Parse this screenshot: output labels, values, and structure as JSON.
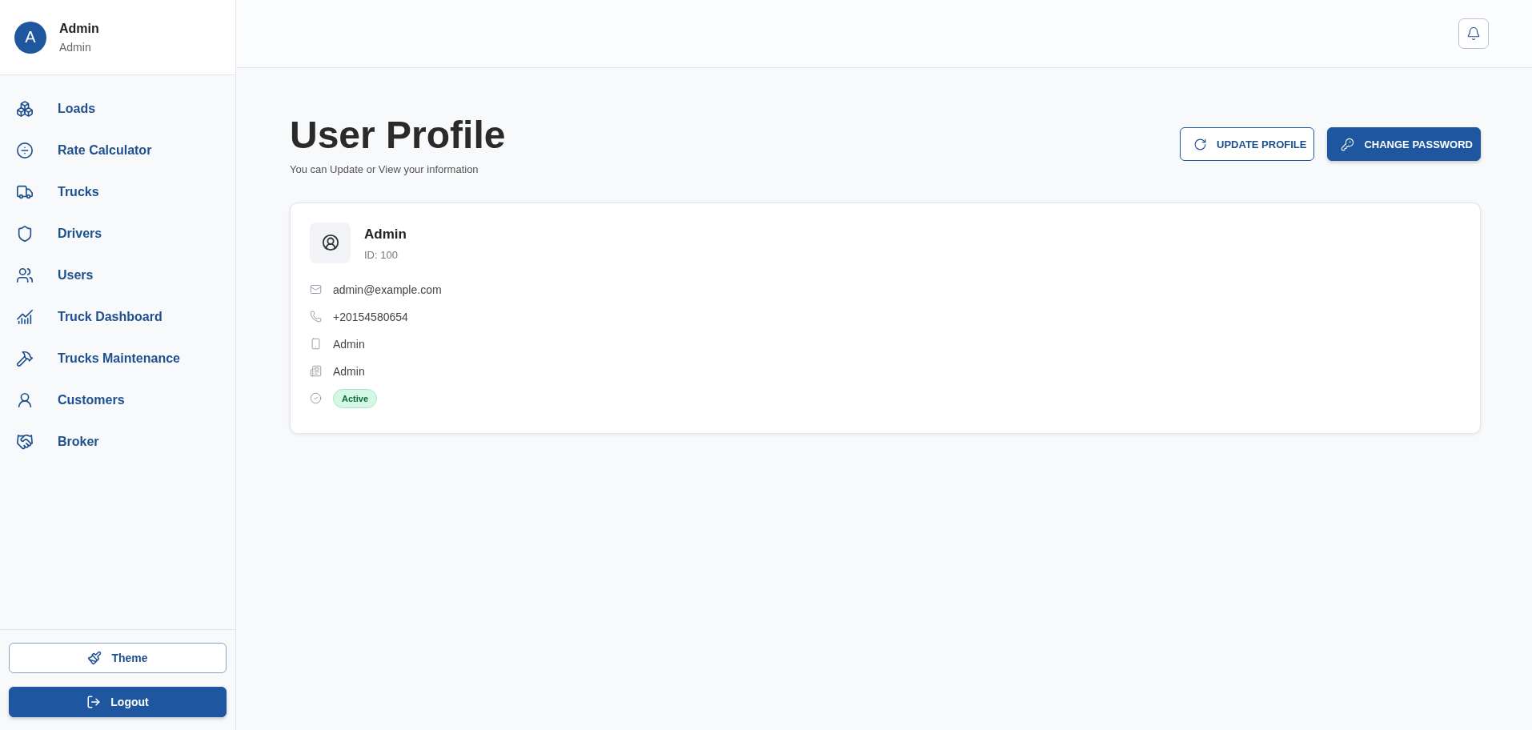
{
  "user": {
    "initial": "A",
    "name": "Admin",
    "role": "Admin"
  },
  "nav": [
    {
      "label": "Loads"
    },
    {
      "label": "Rate Calculator"
    },
    {
      "label": "Trucks"
    },
    {
      "label": "Drivers"
    },
    {
      "label": "Users"
    },
    {
      "label": "Truck Dashboard"
    },
    {
      "label": "Trucks Maintenance"
    },
    {
      "label": "Customers"
    },
    {
      "label": "Broker"
    }
  ],
  "sidebar_buttons": [
    {
      "label": "Theme",
      "kind": "outline"
    },
    {
      "label": "Logout",
      "kind": "solid"
    }
  ],
  "page": {
    "title": "User Profile",
    "subtitle": "You can Update or View your information"
  },
  "actions": [
    {
      "label": "UPDATE PROFILE",
      "kind": "outline"
    },
    {
      "label": "CHANGE PASSWORD",
      "kind": "solid"
    }
  ],
  "profile": {
    "name": "Admin",
    "id": "ID: 100"
  },
  "details": [
    {
      "kind": "email",
      "value": "admin@example.com"
    },
    {
      "kind": "phone",
      "value": "+20154580654"
    },
    {
      "kind": "device",
      "value": "Admin"
    },
    {
      "kind": "role",
      "value": "Admin"
    },
    {
      "kind": "status",
      "value": "Active"
    }
  ]
}
